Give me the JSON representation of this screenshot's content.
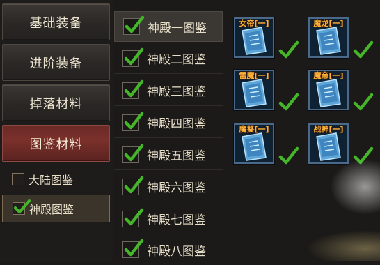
{
  "categories": [
    {
      "label": "基础装备",
      "active": false
    },
    {
      "label": "进阶装备",
      "active": false
    },
    {
      "label": "掉落材料",
      "active": false
    },
    {
      "label": "图鉴材料",
      "active": true
    }
  ],
  "sub_options": [
    {
      "label": "大陆图鉴",
      "checked": false
    },
    {
      "label": "神殿图鉴",
      "checked": true
    }
  ],
  "temple_list": [
    {
      "label": "神殿一图鉴",
      "checked": true,
      "selected": true
    },
    {
      "label": "神殿二图鉴",
      "checked": true,
      "selected": false
    },
    {
      "label": "神殿三图鉴",
      "checked": true,
      "selected": false
    },
    {
      "label": "神殿四图鉴",
      "checked": true,
      "selected": false
    },
    {
      "label": "神殿五图鉴",
      "checked": true,
      "selected": false
    },
    {
      "label": "神殿六图鉴",
      "checked": true,
      "selected": false
    },
    {
      "label": "神殿七图鉴",
      "checked": true,
      "selected": false
    },
    {
      "label": "神殿八图鉴",
      "checked": true,
      "selected": false
    }
  ],
  "cards": [
    {
      "label": "女帝[一]",
      "checked": true
    },
    {
      "label": "魔龙[一]",
      "checked": true
    },
    {
      "label": "雷魔[一]",
      "checked": true
    },
    {
      "label": "魔帝[一]",
      "checked": true
    },
    {
      "label": "魔葵[一]",
      "checked": true
    },
    {
      "label": "战神[一]",
      "checked": true
    }
  ],
  "colors": {
    "check": "#45b52a",
    "card_label": "#ffb23a",
    "active_category": "#7b302b"
  }
}
